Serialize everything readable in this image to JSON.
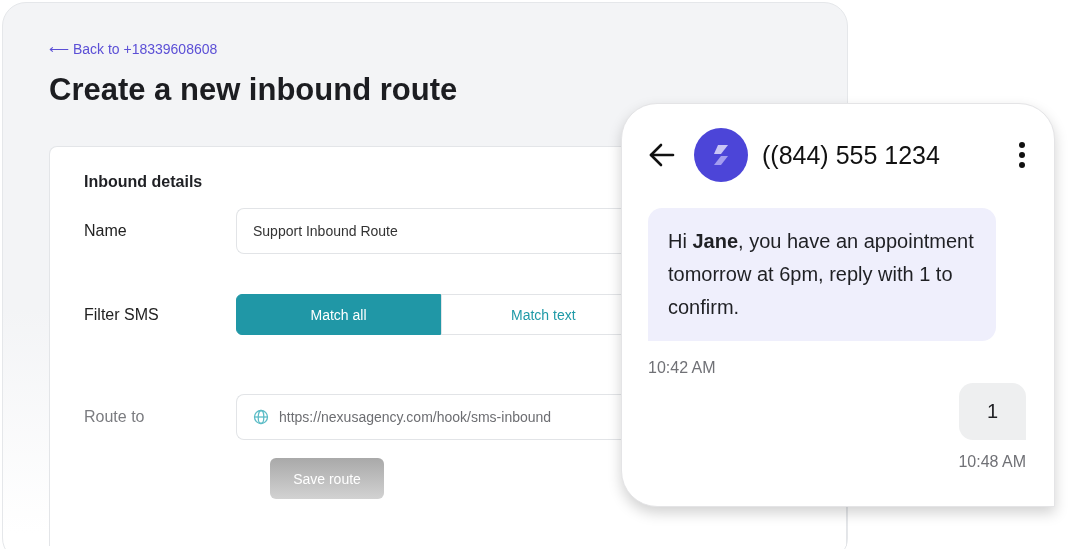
{
  "back_link": "⟵ Back to +18339608608",
  "title": "Create a new inbound route",
  "form": {
    "heading": "Inbound details",
    "name": {
      "label": "Name",
      "value": "Support Inbound Route"
    },
    "filter": {
      "label": "Filter SMS",
      "options": [
        {
          "label": "Match all",
          "selected": true
        },
        {
          "label": "Match text",
          "selected": false
        }
      ]
    },
    "route_to": {
      "label": "Route to",
      "value": "https://nexusagency.com/hook/sms-inbound",
      "disabled": true
    },
    "save_button": {
      "label": "Save route",
      "disabled": true
    }
  },
  "phone": {
    "contact": "((844) 555 1234",
    "messages": [
      {
        "kind": "incoming",
        "text": "Hi **Jane**, you have an appointment tomorrow at 6pm, reply with 1 to confirm.",
        "time": "10:42 AM"
      },
      {
        "kind": "outgoing",
        "text": "1",
        "time": "10:48 AM"
      }
    ]
  }
}
